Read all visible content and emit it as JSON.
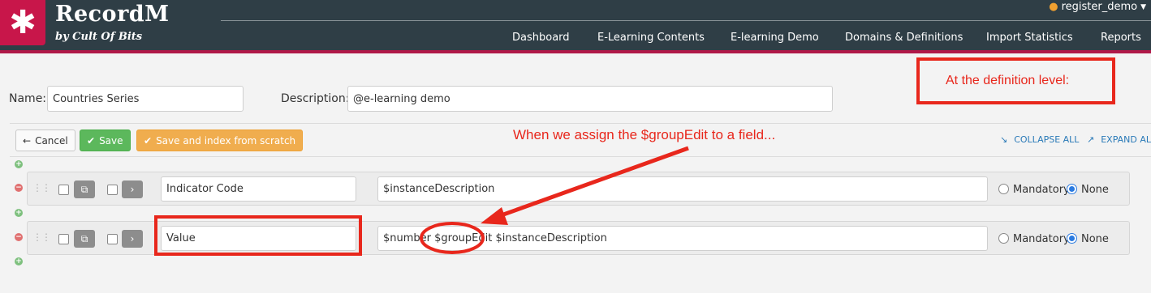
{
  "brand": {
    "logo_glyph": "✱",
    "title": "RecordM",
    "subtitle": "by Cult Of Bits",
    "colors": {
      "header": "#2f3e46",
      "accent": "#b01848",
      "logo": "#c8164a"
    }
  },
  "user_menu": {
    "username": "register_demo",
    "icon": "person-icon"
  },
  "nav": {
    "items": [
      {
        "label": "Dashboard"
      },
      {
        "label": "E-Learning Contents"
      },
      {
        "label": "E-learning Demo"
      },
      {
        "label": "Domains & Definitions"
      },
      {
        "label": "Import Statistics"
      },
      {
        "label": "Reports"
      }
    ]
  },
  "form": {
    "name_label": "Name:",
    "name_value": "Countries Series",
    "description_label": "Description:",
    "description_value": "@e-learning demo"
  },
  "toolbar": {
    "cancel_label": "Cancel",
    "save_label": "Save",
    "save_index_label": "Save and index from scratch",
    "collapse_all": "COLLAPSE ALL",
    "expand_all": "EXPAND ALL"
  },
  "fields": [
    {
      "name": "Indicator Code",
      "description": "$instanceDescription",
      "mandatory_label": "Mandatory",
      "none_label": "None",
      "selected": "None"
    },
    {
      "name": "Value",
      "description": "$number $groupEdit $instanceDescription",
      "mandatory_label": "Mandatory",
      "none_label": "None",
      "selected": "None"
    }
  ],
  "annotations": {
    "definition_level": "At the definition level:",
    "assign_note": "When we assign the $groupEdit to a field...",
    "color": "#e8271c"
  }
}
